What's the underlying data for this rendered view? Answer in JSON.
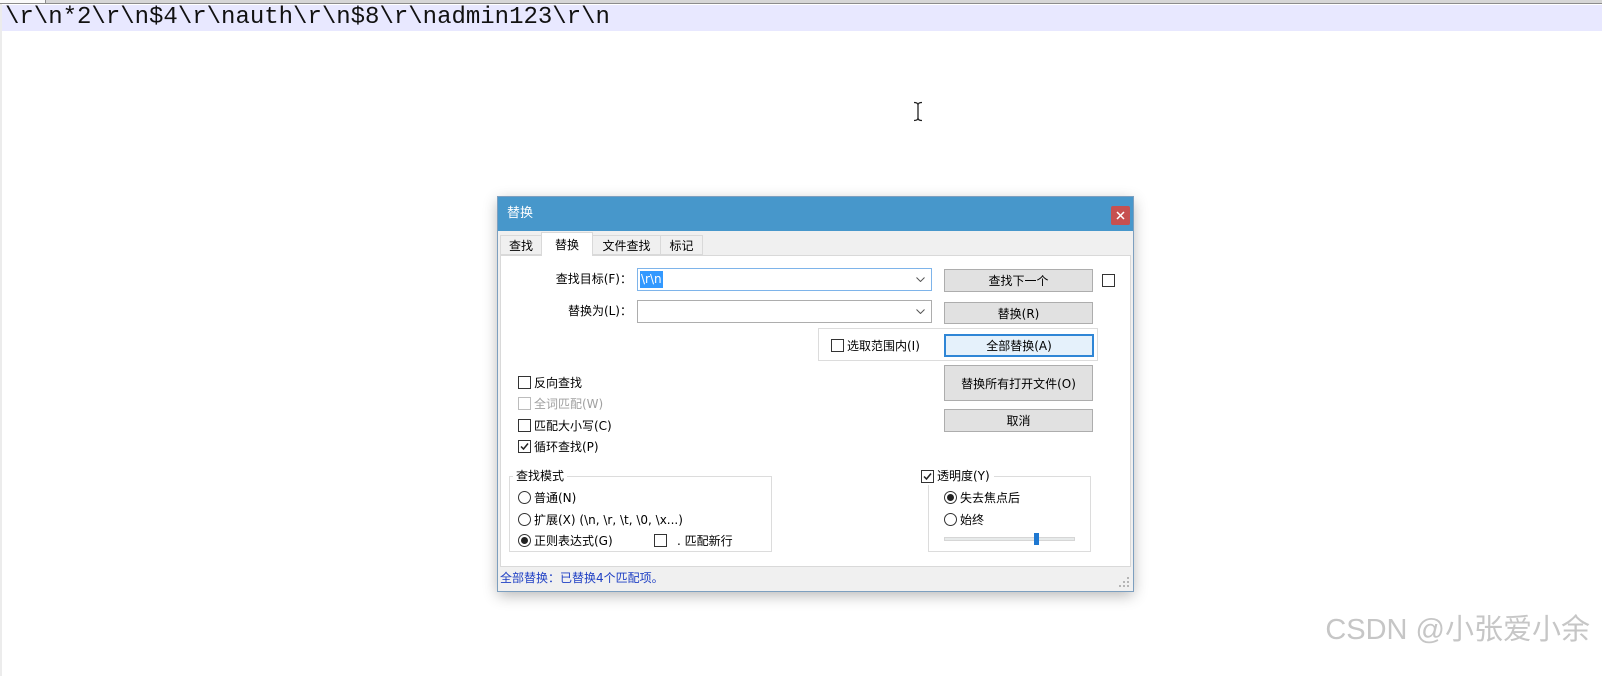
{
  "editor": {
    "line_text": "\\r\\n*2\\r\\n$4\\r\\nauth\\r\\n$8\\r\\nadmin123\\r\\n"
  },
  "dialog": {
    "title": "替换",
    "tabs": [
      {
        "label": "查找",
        "selected": false
      },
      {
        "label": "替换",
        "selected": true
      },
      {
        "label": "文件查找",
        "selected": false
      },
      {
        "label": "标记",
        "selected": false
      }
    ],
    "find": {
      "label": "查找目标(F)：",
      "value": "\\r\\n",
      "value_selected": true,
      "focused": true
    },
    "replace": {
      "label": "替换为(L)：",
      "value": ""
    },
    "find_next_option_checked": false,
    "buttons": {
      "find_next": {
        "label": "查找下一个",
        "focused": false
      },
      "replace": {
        "label": "替换(R)",
        "focused": false
      },
      "replace_all": {
        "label": "全部替换(A)",
        "focused": true
      },
      "replace_all_open": {
        "label": "替换所有打开文件(O)",
        "focused": false
      },
      "cancel": {
        "label": "取消",
        "focused": false
      }
    },
    "in_selection": {
      "label": "选取范围内(I)",
      "checked": false
    },
    "options": [
      {
        "label": "反向查找",
        "checked": false,
        "disabled": false
      },
      {
        "label": "全词匹配(W)",
        "checked": false,
        "disabled": true
      },
      {
        "label": "匹配大小写(C)",
        "checked": false,
        "disabled": false
      },
      {
        "label": "循环查找(P)",
        "checked": true,
        "disabled": false
      }
    ],
    "search_mode": {
      "title": "查找模式",
      "modes": [
        {
          "label": "普通(N)",
          "selected": false
        },
        {
          "label": "扩展(X) (\\n, \\r, \\t, \\0, \\x...)",
          "selected": false
        },
        {
          "label": "正则表达式(G)",
          "selected": true
        }
      ],
      "dot_newline": {
        "label": ". 匹配新行",
        "checked": false
      }
    },
    "transparency": {
      "label": "透明度(Y)",
      "enabled": true,
      "modes": [
        {
          "label": "失去焦点后",
          "selected": true
        },
        {
          "label": "始终",
          "selected": false
        }
      ],
      "level": 0.71
    },
    "status": "全部替换：已替换4个匹配项。"
  },
  "watermark": "CSDN @小张爱小余",
  "icons": {
    "close": "close-icon",
    "dropdown": "chevron-down-icon",
    "pointer": "text-cursor-icon",
    "grip": "resize-grip-icon",
    "check": "checkmark-icon"
  },
  "colors": {
    "title_bar": "#4797cb",
    "close_button": "#c75050",
    "current_line": "#e8e8ff",
    "selection": "#3399ff",
    "status_text": "#1e3fc4",
    "slider_thumb": "#1f78d1",
    "focus_border": "#2f86d6"
  }
}
